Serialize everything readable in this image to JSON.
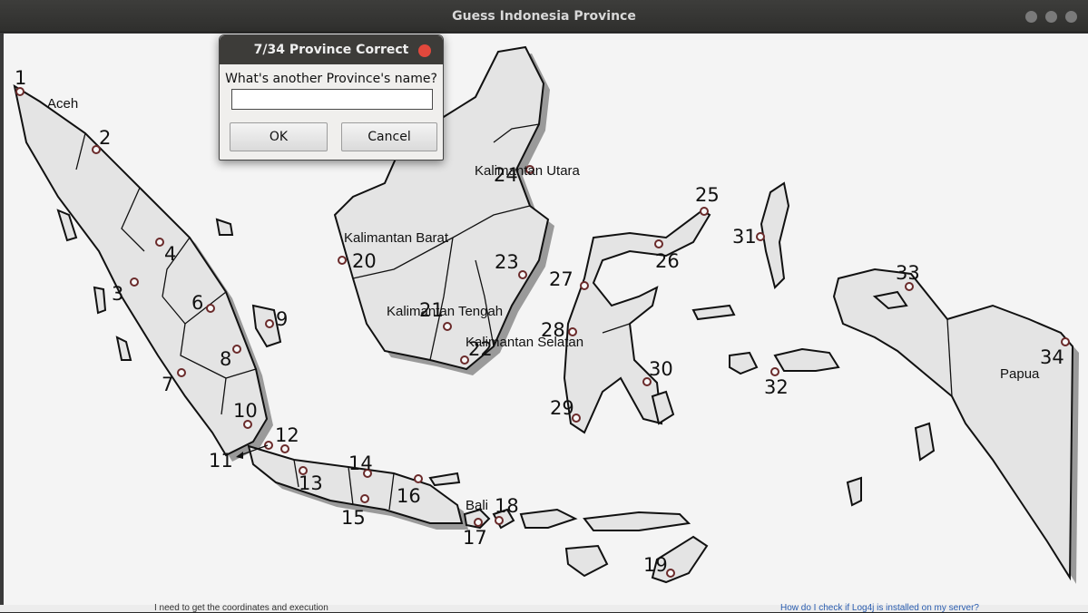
{
  "window": {
    "title": "Guess Indonesia Province"
  },
  "dialog": {
    "title": "7/34 Province Correct",
    "prompt": "What's another Province's name?",
    "input_value": "",
    "ok_label": "OK",
    "cancel_label": "Cancel"
  },
  "map": {
    "markers": [
      {
        "num": "1"
      },
      {
        "num": "2"
      },
      {
        "num": "3"
      },
      {
        "num": "4"
      },
      {
        "num": "6"
      },
      {
        "num": "7"
      },
      {
        "num": "8"
      },
      {
        "num": "9"
      },
      {
        "num": "10"
      },
      {
        "num": "11"
      },
      {
        "num": "12"
      },
      {
        "num": "13"
      },
      {
        "num": "14"
      },
      {
        "num": "15"
      },
      {
        "num": "16"
      },
      {
        "num": "17"
      },
      {
        "num": "18"
      },
      {
        "num": "19"
      },
      {
        "num": "20"
      },
      {
        "num": "21"
      },
      {
        "num": "22"
      },
      {
        "num": "23"
      },
      {
        "num": "24"
      },
      {
        "num": "25"
      },
      {
        "num": "26"
      },
      {
        "num": "27"
      },
      {
        "num": "28"
      },
      {
        "num": "29"
      },
      {
        "num": "30"
      },
      {
        "num": "31"
      },
      {
        "num": "32"
      },
      {
        "num": "33"
      },
      {
        "num": "34"
      }
    ],
    "province_labels": [
      "Aceh",
      "Kalimantan Utara",
      "Kalimantan Barat",
      "Kalimantan Tengah",
      "Kalimantan Selatan",
      "Bali",
      "Papua"
    ]
  },
  "background_snippets": {
    "left_text": "I need to get the coordinates and execution",
    "right_link": "How do I check if Log4j is installed on my server?"
  },
  "colors": {
    "title_bar": "#3d3d3b",
    "close_button": "#e2483c",
    "map_bg": "#f4f4f4",
    "land": "#e4e4e4"
  }
}
